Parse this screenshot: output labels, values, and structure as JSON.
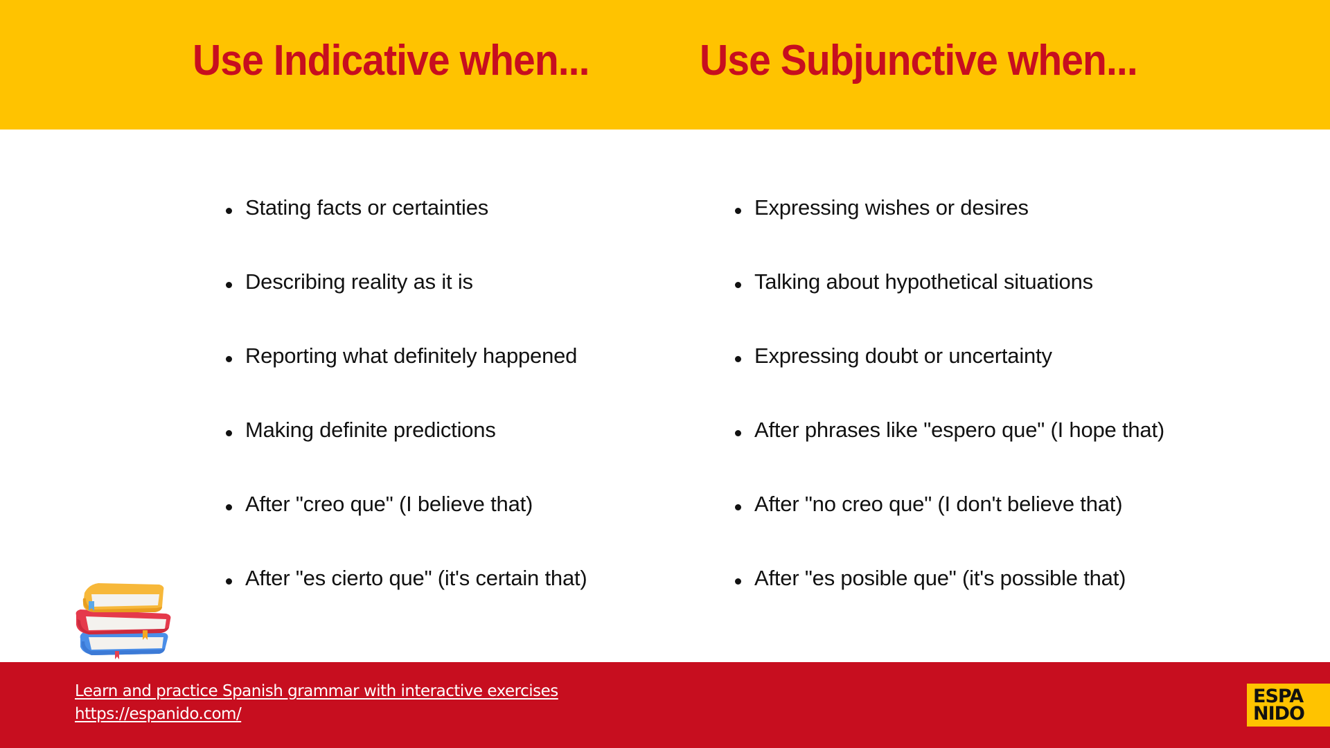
{
  "colors": {
    "header_bg": "#FFC300",
    "heading_text": "#C70E1F",
    "footer_bg": "#C70E1F",
    "logo_bg": "#FFC300",
    "body_text": "#111111"
  },
  "header": {
    "indicative_title": "Use Indicative when...",
    "subjunctive_title": "Use Subjunctive when..."
  },
  "indicative": {
    "items": [
      "Stating facts or certainties",
      "Describing reality as it is",
      "Reporting what definitely happened",
      "Making definite predictions",
      "After \"creo que\" (I believe that)",
      "After \"es cierto que\" (it's certain that)"
    ]
  },
  "subjunctive": {
    "items": [
      "Expressing wishes or desires",
      "Talking about hypothetical situations",
      "Expressing doubt or uncertainty",
      "After phrases like \"espero que\" (I hope that)",
      "After \"no creo que\" (I don't believe that)",
      "After \"es posible que\" (it's possible that)"
    ]
  },
  "decoration": {
    "books_icon": "stack-of-books-icon"
  },
  "footer": {
    "tagline_link": "Learn and practice Spanish grammar with interactive exercises",
    "url_link": "https://espanido.com/",
    "logo_line1": "ESPA",
    "logo_line2": "NIDO"
  }
}
